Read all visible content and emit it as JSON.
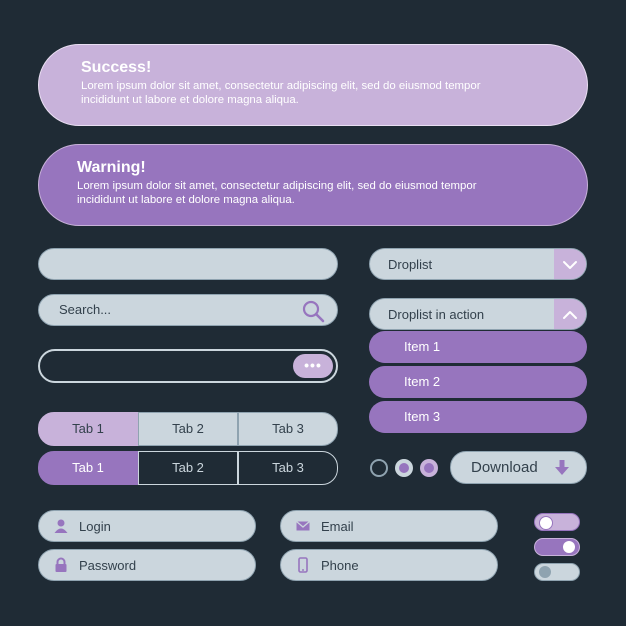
{
  "alerts": {
    "success": {
      "title": "Success!",
      "line1": "Lorem ipsum dolor sit amet, consectetur adipiscing elit, sed do eiusmod tempor",
      "line2": "incididunt ut labore et dolore magna aliqua."
    },
    "warning": {
      "title": "Warning!",
      "line1": "Lorem ipsum dolor sit amet, consectetur adipiscing elit, sed do eiusmod tempor",
      "line2": "incididunt ut labore et dolore magna aliqua."
    }
  },
  "search": {
    "placeholder": "Search..."
  },
  "message": {
    "button_label": "•••"
  },
  "tabs_light": [
    "Tab 1",
    "Tab 2",
    "Tab 3"
  ],
  "tabs_dark": [
    "Tab 1",
    "Tab 2",
    "Tab 3"
  ],
  "droplist": {
    "label": "Droplist"
  },
  "droplist_action": {
    "label": "Droplist in action",
    "items": [
      "Item 1",
      "Item 2",
      "Item 3"
    ]
  },
  "download": {
    "label": "Download"
  },
  "login_fields": {
    "login": "Login",
    "password": "Password",
    "email": "Email",
    "phone": "Phone"
  },
  "colors": {
    "background": "#1f2b35",
    "light_purple": "#c8b2da",
    "purple": "#9775be",
    "grey": "#cbd6dd"
  }
}
